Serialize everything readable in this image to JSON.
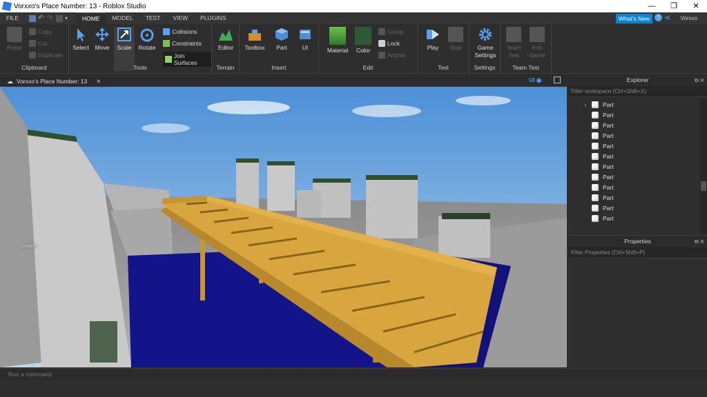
{
  "window": {
    "title": "Vorxxo's Place Number: 13 - Roblox Studio",
    "controls": [
      "—",
      "❐",
      "✕"
    ]
  },
  "menubar": {
    "tabs": [
      {
        "label": "FILE"
      },
      {
        "label": "HOME"
      },
      {
        "label": "MODEL"
      },
      {
        "label": "TEST"
      },
      {
        "label": "VIEW"
      },
      {
        "label": "PLUGINS"
      }
    ],
    "active": "HOME",
    "whats_new": "What's New",
    "user": "Vorxxo"
  },
  "ribbon": {
    "clipboard": {
      "label": "Clipboard",
      "paste": "Paste",
      "copy": "Copy",
      "cut": "Cut",
      "duplicate": "Duplicate"
    },
    "tools": {
      "label": "Tools",
      "select": "Select",
      "move": "Move",
      "scale": "Scale",
      "rotate": "Rotate",
      "collisions": "Collisions",
      "constraints": "Constraints",
      "join_surfaces": "Join Surfaces"
    },
    "terrain": {
      "label": "Terrain",
      "editor": "Editor"
    },
    "insert": {
      "label": "Insert",
      "toolbox": "Toolbox",
      "part": "Part",
      "ui": "UI"
    },
    "edit": {
      "label": "Edit",
      "material": "Material",
      "color": "Color",
      "group": "Group",
      "lock": "Lock",
      "anchor": "Anchor"
    },
    "test": {
      "label": "Test",
      "play": "Play",
      "stop": "Stop"
    },
    "settings": {
      "label": "Settings",
      "game_settings_1": "Game",
      "game_settings_2": "Settings"
    },
    "team_test": {
      "label": "Team Test",
      "team_test_1": "Team",
      "team_test_2": "Test",
      "exit_game_1": "Exit",
      "exit_game_2": "Game"
    }
  },
  "document": {
    "tab_label": "Vorxxo's Place Number: 13",
    "close": "✕",
    "ui_toggle": "UI"
  },
  "viewport": {
    "dummy_label": "Dummy"
  },
  "explorer": {
    "title": "Explorer",
    "filter_placeholder": "Filter workspace (Ctrl+Shift+X)",
    "items": [
      "Part",
      "Part",
      "Part",
      "Part",
      "Part",
      "Part",
      "Part",
      "Part",
      "Part",
      "Part",
      "Part",
      "Part"
    ]
  },
  "properties": {
    "title": "Properties",
    "filter_placeholder": "Filter Properties (Ctrl+Shift+P)"
  },
  "command_bar": {
    "placeholder": "Run a command"
  },
  "colors": {
    "accent": "#0a84d6",
    "panel": "#2e2e2e",
    "water": "#14148a",
    "wood": "#d4a23a"
  }
}
